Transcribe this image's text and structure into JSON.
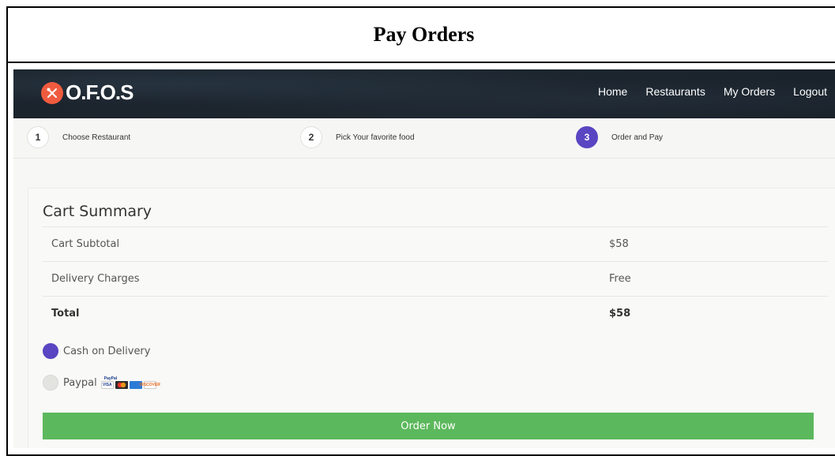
{
  "frame": {
    "title": "Pay Orders"
  },
  "navbar": {
    "brand": "O.F.O.S",
    "links": [
      {
        "label": "Home"
      },
      {
        "label": "Restaurants"
      },
      {
        "label": "My Orders"
      },
      {
        "label": "Logout"
      }
    ]
  },
  "steps": [
    {
      "number": "1",
      "label": "Choose Restaurant",
      "active": false
    },
    {
      "number": "2",
      "label": "Pick Your favorite food",
      "active": false
    },
    {
      "number": "3",
      "label": "Order and Pay",
      "active": true
    }
  ],
  "cart": {
    "title": "Cart Summary",
    "rows": [
      {
        "label": "Cart Subtotal",
        "value": "$58"
      },
      {
        "label": "Delivery Charges",
        "value": "Free"
      },
      {
        "label": "Total",
        "value": "$58"
      }
    ]
  },
  "payment": {
    "options": [
      {
        "label": "Cash on Delivery",
        "checked": true
      },
      {
        "label": "Paypal",
        "checked": false
      }
    ],
    "paypal_badge": "PayPal",
    "card_logos": [
      "VISA",
      "",
      "",
      "DISCOVER"
    ]
  },
  "order_button": {
    "label": "Order Now"
  },
  "colors": {
    "accent": "#5a45c2",
    "button": "#5cb85c",
    "brand": "#f05b3f",
    "navbar": "#1e2730"
  }
}
